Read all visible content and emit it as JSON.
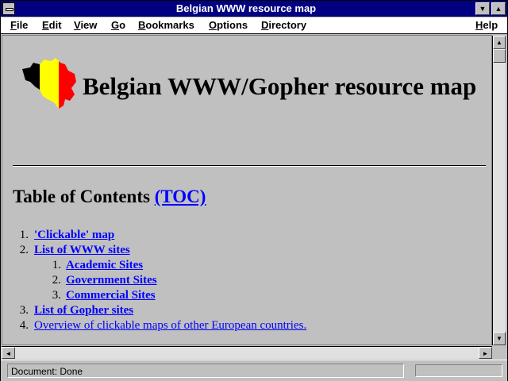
{
  "window": {
    "title": "Belgian WWW resource map"
  },
  "menu": [
    {
      "label": "File",
      "key": "F"
    },
    {
      "label": "Edit",
      "key": "E"
    },
    {
      "label": "View",
      "key": "V"
    },
    {
      "label": "Go",
      "key": "G"
    },
    {
      "label": "Bookmarks",
      "key": "B"
    },
    {
      "label": "Options",
      "key": "O"
    },
    {
      "label": "Directory",
      "key": "D"
    },
    {
      "label": "Help",
      "key": "H"
    }
  ],
  "page": {
    "heading": "Belgian WWW/Gopher resource map",
    "toc_heading": "Table of Contents",
    "toc_link": "(TOC)",
    "toc": [
      {
        "num": "1.",
        "label": "'Clickable' map",
        "level": 1
      },
      {
        "num": "2.",
        "label": "List of WWW sites",
        "level": 1
      },
      {
        "num": "1.",
        "label": "Academic Sites",
        "level": 2
      },
      {
        "num": "2.",
        "label": "Government Sites",
        "level": 2
      },
      {
        "num": "3.",
        "label": "Commercial Sites",
        "level": 2
      },
      {
        "num": "3.",
        "label": "List of Gopher sites",
        "level": 1
      },
      {
        "num": "4.",
        "label": "Overview of clickable maps of other European countries.",
        "level": 1
      }
    ]
  },
  "status": {
    "text": "Document: Done"
  },
  "colors": {
    "titlebar": "#000080",
    "link": "#0000ff",
    "background": "#c0c0c0",
    "flag_black": "#000000",
    "flag_yellow": "#ffff00",
    "flag_red": "#ff0000"
  }
}
